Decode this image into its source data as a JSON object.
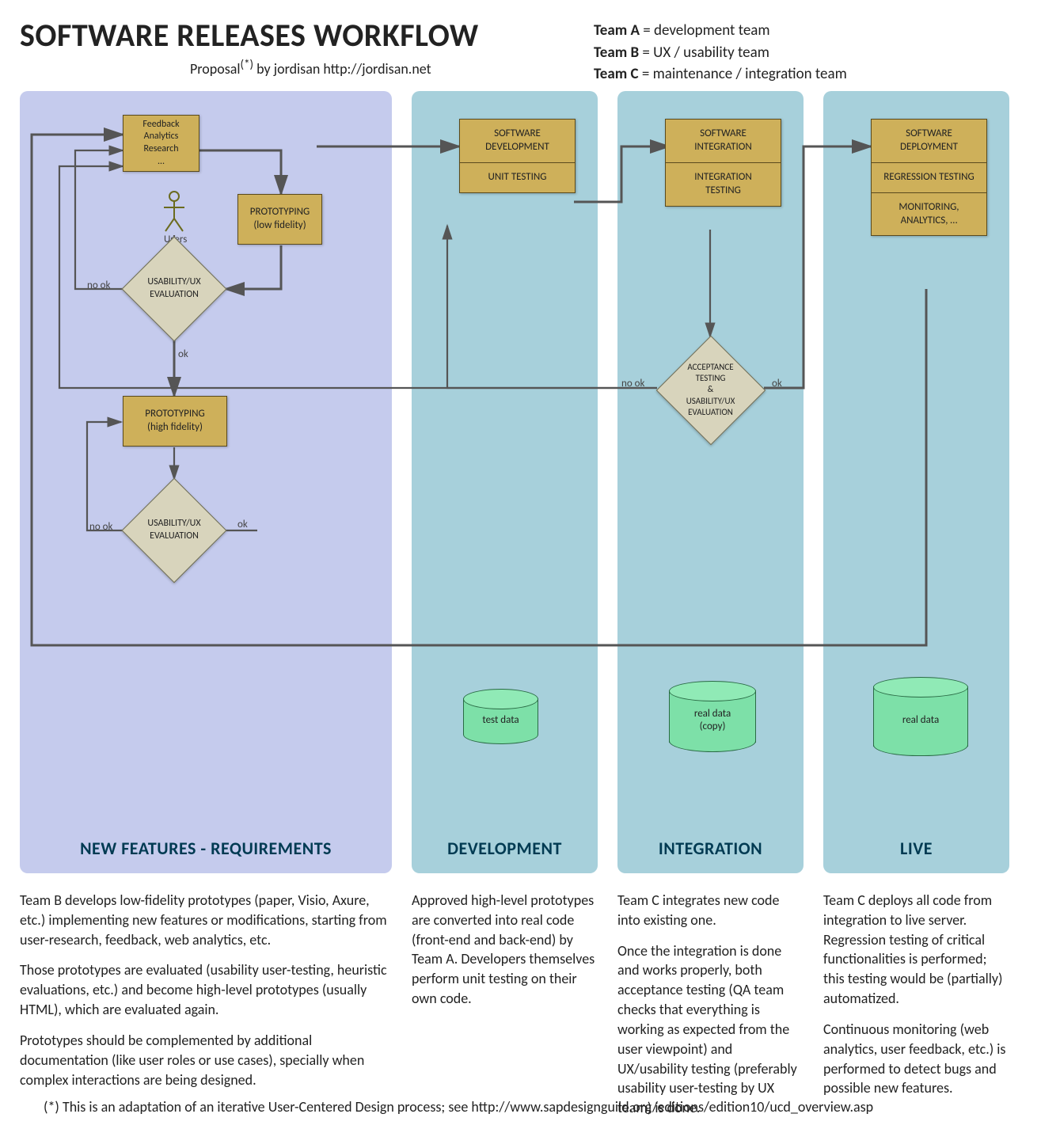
{
  "header": {
    "title": "SOFTWARE RELEASES WORKFLOW",
    "subtitle_prefix": "Proposal",
    "subtitle_sup": "(*)",
    "subtitle_by": " by jordisan   ",
    "subtitle_url": "http://jordisan.net"
  },
  "legend": {
    "a_label": "Team A",
    "a_desc": " = development team",
    "b_label": "Team B",
    "b_desc": " = UX / usability team",
    "c_label": "Team C",
    "c_desc": " = maintenance / integration team"
  },
  "lanes": {
    "l1": "NEW FEATURES - REQUIREMENTS",
    "l2": "DEVELOPMENT",
    "l3": "INTEGRATION",
    "l4": "LIVE"
  },
  "nodes": {
    "feedback": "Feedback\nAnalytics\nResearch\n…",
    "proto_low": "PROTOTYPING\n(low fidelity)",
    "users": "Users",
    "ux_eval_1": "USABILITY/UX\nEVALUATION",
    "proto_high": "PROTOTYPING\n(high fidelity)",
    "ux_eval_2": "USABILITY/UX\nEVALUATION",
    "dev_a": "SOFTWARE\nDEVELOPMENT",
    "dev_b": "UNIT TESTING",
    "int_a": "SOFTWARE\nINTEGRATION",
    "int_b": "INTEGRATION\nTESTING",
    "accept": "ACCEPTANCE\nTESTING\n&\nUSABILITY/UX\nEVALUATION",
    "live_a": "SOFTWARE\nDEPLOYMENT",
    "live_b": "REGRESSION TESTING",
    "live_c": "MONITORING,\nANALYTICS, …",
    "cyl_test": "test data",
    "cyl_copy": "real data\n(copy)",
    "cyl_real": "real data"
  },
  "edge_labels": {
    "no_ok_1": "no ok",
    "ok_1": "ok",
    "no_ok_2": "no ok",
    "ok_2": "ok",
    "no_ok_3": "no ok",
    "ok_3": "ok"
  },
  "descriptions": {
    "d1_p1": "Team B develops low-fidelity prototypes (paper, Visio, Axure, etc.) implementing new features or modifications, starting from user-research, feedback, web analytics, etc.",
    "d1_p2": "Those prototypes are evaluated (usability user-testing, heuristic evaluations, etc.) and become high-level prototypes (usually HTML), which are evaluated again.",
    "d1_p3": "Prototypes should be complemented by additional documentation (like user roles or use cases), specially when complex interactions are being designed.",
    "d2_p1": "Approved high-level prototypes are converted into real code (front-end and back-end) by Team A. Developers themselves perform unit testing on their own code.",
    "d3_p1": "Team C integrates new code into existing one.",
    "d3_p2": "Once the integration is done and works properly, both acceptance testing (QA team checks that everything is working as expected from the user viewpoint) and UX/usability testing (preferably usability user-testing by UX team) is done.",
    "d4_p1": "Team C deploys all code from integration to live server. Regression testing of critical functionalities is performed; this testing would be (partially) automatized.",
    "d4_p2": "Continuous monitoring (web analytics, user feedback, etc.) is performed to detect bugs and possible new features."
  },
  "footnote": "(*) This is an adaptation of an iterative User-Centered Design process; see http://www.sapdesignguild.org/editions/edition10/ucd_overview.asp"
}
